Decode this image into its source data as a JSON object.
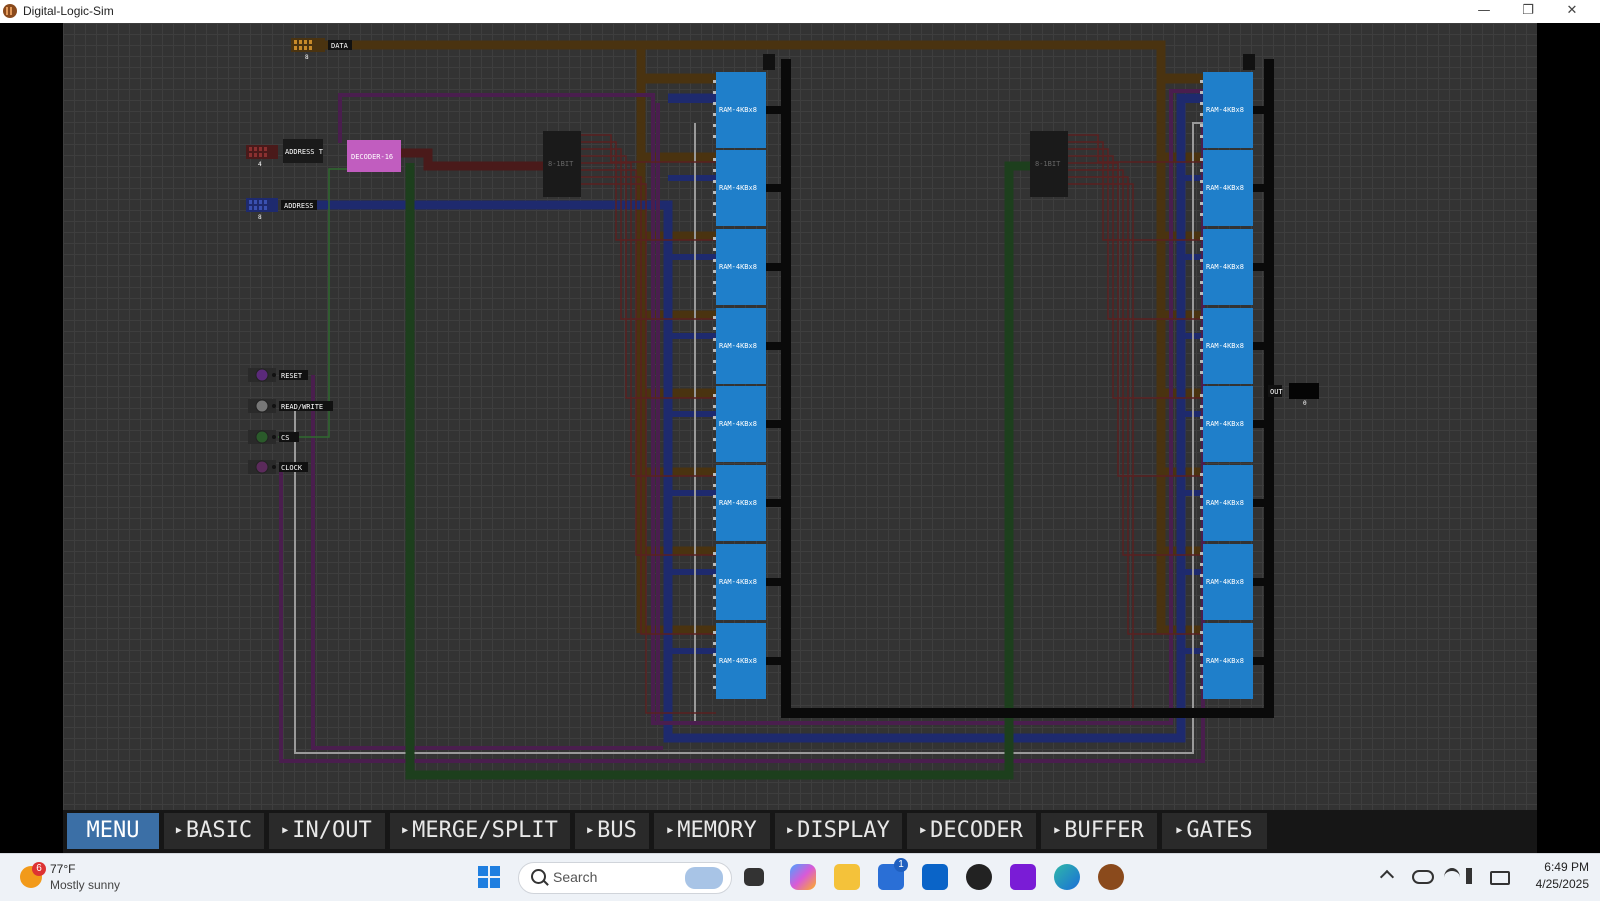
{
  "window": {
    "title": "Digital-Logic-Sim",
    "minimize": "—",
    "restore": "❐",
    "close": "✕"
  },
  "canvas": {
    "inputs": {
      "data_label": "DATA",
      "data_bits": "8",
      "address_t_label": "ADDRESS T",
      "address_t_bits": "4",
      "address_label": "ADDRESS",
      "address_bits": "8"
    },
    "pins": [
      {
        "label": "RESET",
        "color": "#5b2a7a"
      },
      {
        "label": "READ/WRITE",
        "color": "#777777"
      },
      {
        "label": "CS",
        "color": "#2a5a2a"
      },
      {
        "label": "CLOCK",
        "color": "#5b2a5b"
      }
    ],
    "decoder_label": "DECODER-16",
    "splitter_label": "8-1BIT",
    "ram_label": "RAM-4KBx8",
    "output_label": "OUT",
    "output_value": "0"
  },
  "menu": {
    "items": [
      "MENU",
      "BASIC",
      "IN/OUT",
      "MERGE/SPLIT",
      "BUS",
      "MEMORY",
      "DISPLAY",
      "DECODER",
      "BUFFER",
      "GATES"
    ]
  },
  "taskbar": {
    "weather": {
      "badge": "6",
      "temp": "77°F",
      "condition": "Mostly sunny"
    },
    "search_placeholder": "Search",
    "store_badge": "1",
    "clock": {
      "time": "6:49 PM",
      "date": "4/25/2025"
    }
  },
  "colors": {
    "ram": "#1f7fca",
    "decoder": "#c15dbf",
    "data_bus": "#4a3310",
    "addr_bus": "#1e2a6e",
    "cs_wire": "#1d3f1d",
    "accent_menu": "#3b6fa6"
  }
}
